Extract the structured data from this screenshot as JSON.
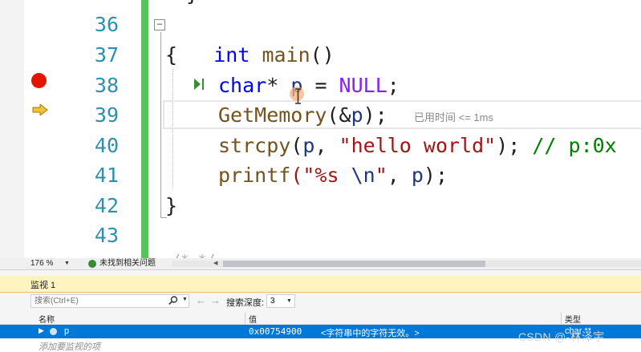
{
  "editor": {
    "lines": [
      {
        "number": "36",
        "code": "int main()"
      },
      {
        "number": "37",
        "code": "{"
      },
      {
        "number": "38",
        "code": "char* p = NULL;"
      },
      {
        "number": "39",
        "code": "GetMemory(&p);"
      },
      {
        "number": "40",
        "code": "strcpy(p, \"hello world\"); // p:0x"
      },
      {
        "number": "41",
        "code": "printf(\"%s \\n\", p);"
      },
      {
        "number": "42",
        "code": "}"
      },
      {
        "number": "43",
        "code": ""
      }
    ],
    "tokens": {
      "int": "int",
      "main": "main",
      "parens": "()",
      "char": "char",
      "star_p": "* ",
      "p": "p",
      "eq": " = ",
      "null": "NULL",
      "semi": ";",
      "getmemory": "GetMemory",
      "amp": "(&",
      "close": ");",
      "strcpy": "strcpy",
      "open_p": "(",
      "comma": ", ",
      "hello": "\"hello world\"",
      "close_semi": "); ",
      "comment": "// p:0x",
      "printf": "printf",
      "fmt_a": "(\"%s ",
      "fmt_esc": "\\n",
      "fmt_b": "\"",
      "comma2": ", ",
      "p2": "p",
      "close2": ");",
      "open_brace": "{",
      "close_brace": "}"
    },
    "perf_tip": "已用时间 <= 1ms",
    "breakpoint_line": "38",
    "current_line": "39",
    "colors": {
      "keyword": "#0000ff",
      "function": "#74531f",
      "variable": "#1f377f",
      "macro": "#8a1bff",
      "string": "#a31515",
      "comment": "#008000",
      "line_number": "#2b91af",
      "change_bar": "#57c35d",
      "breakpoint": "#e51400",
      "exec_arrow": "#f0c23b"
    }
  },
  "status_bar": {
    "zoom": "176 %",
    "issues": "未找到相关问题"
  },
  "watch": {
    "title": "监视 1",
    "search_placeholder": "搜索(Ctrl+E)",
    "search_depth_label": "搜索深度:",
    "search_depth_value": "3",
    "columns": {
      "name": "名称",
      "value": "值",
      "type": "类型"
    },
    "rows": [
      {
        "name": "p",
        "value": "0x00754900",
        "message": "<字符串中的字符无效。>",
        "type": "char **"
      }
    ],
    "add_item_placeholder": "添加要监视的项",
    "selection_color": "#0078d7"
  },
  "watermark": "CSDN @-林泽宇"
}
